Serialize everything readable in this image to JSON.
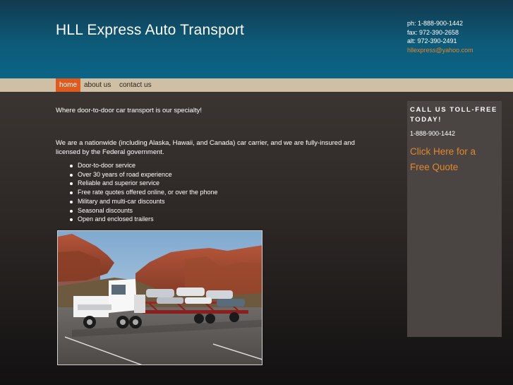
{
  "header": {
    "title": "HLL Express Auto Transport",
    "phone": "ph: 1-888-900-1442",
    "fax": "fax: 972-390-2658",
    "alt": "alt: 972-390-2491",
    "email": "hllexpress@yahoo.com"
  },
  "nav": {
    "items": [
      {
        "label": "home"
      },
      {
        "label": "about us"
      },
      {
        "label": "contact us"
      }
    ],
    "active": "home"
  },
  "main": {
    "tagline": "Where door-to-door car transport is our specialty!",
    "intro": "We are a nationwide (including Alaska, Hawaii, and Canada) car carrier, and we are fully-insured and licensed by the Federal government.",
    "features": [
      "Door-to-door service",
      "Over 30 years of road experience",
      "Reliable and superior service",
      "Free rate quotes offered online, or over the phone",
      "Military and multi-car discounts",
      "Seasonal discounts",
      "Open and enclosed trailers"
    ]
  },
  "sidebar": {
    "heading": "CALL US TOLL-FREE TODAY!",
    "phone": "1-888-900-1442",
    "quote_link": "Click Here for a Free Quote"
  },
  "colors": {
    "header_blue": "#0b6486",
    "nav_bar": "#cfbfa5",
    "nav_active": "#e05a1e",
    "link_orange": "#e3862c",
    "sidebar_bg": "#4a4543"
  }
}
